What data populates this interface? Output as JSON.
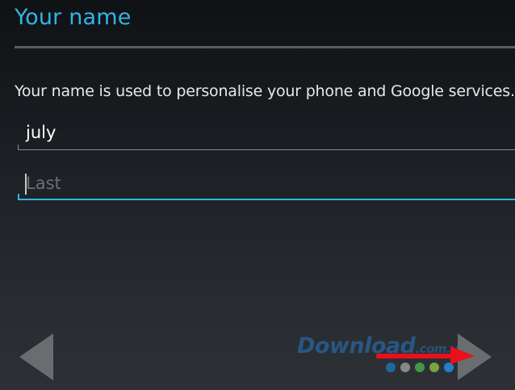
{
  "header": {
    "title": "Your name"
  },
  "main": {
    "description": "Your name is used to personalise your phone and Google services.",
    "first_name": {
      "value": "july"
    },
    "last_name": {
      "value": "",
      "placeholder": "Last"
    }
  },
  "navigation": {
    "back_icon": "chevron-left-icon",
    "next_icon": "chevron-right-icon"
  },
  "watermark": {
    "text": "Download",
    "suffix": ".com.vn",
    "dot_colors": [
      "#1f77b4",
      "#9e9e9e",
      "#4caf50",
      "#8bc34a",
      "#2196f3",
      "#f44336"
    ]
  },
  "annotation": {
    "arrow_color": "#e8101a"
  },
  "colors": {
    "accent": "#33b5e5",
    "background": "#1a1d21",
    "text": "#e8e8e8"
  }
}
